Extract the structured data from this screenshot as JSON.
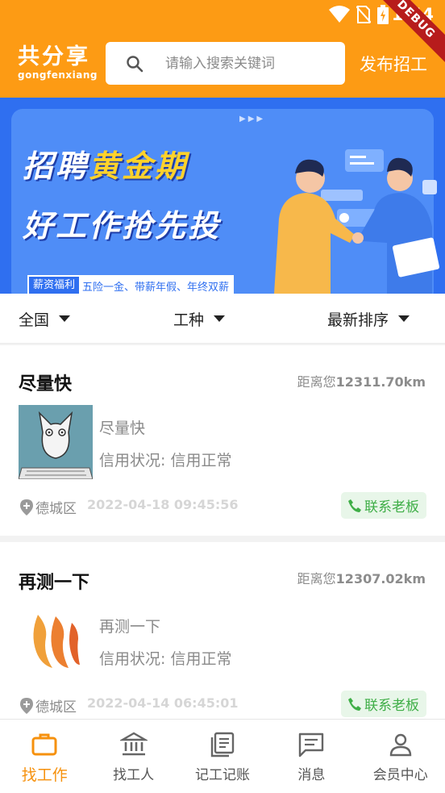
{
  "status_bar": {
    "time": "1:44",
    "debug_label": "DEBUG"
  },
  "header": {
    "logo_main": "共分享",
    "logo_sub": "gongfenxiang",
    "search_placeholder": "请输入搜索关键词",
    "post_job_label": "发布招工",
    "brand_color": "#fd9b14"
  },
  "banner": {
    "title_line1_prefix": "招聘",
    "title_line1_highlight": "黄金期",
    "title_line2": "好工作抢先投",
    "tag_chip": "薪资福利",
    "tag_text": "五险一金、带薪年假、年终双薪"
  },
  "filters": [
    {
      "label": "全国"
    },
    {
      "label": "工种"
    },
    {
      "label": "最新排序"
    }
  ],
  "jobs": [
    {
      "title": "尽量快",
      "distance_prefix": "距离您",
      "distance_value": "12311.70km",
      "name": "尽量快",
      "credit": "信用状况:  信用正常",
      "location": "德城区",
      "time": "2022-04-18 09:45:56",
      "contact_label": "联系老板",
      "thumb_icon": "cat-keyboard-avatar"
    },
    {
      "title": "再测一下",
      "distance_prefix": "距离您",
      "distance_value": "12307.02km",
      "name": "再测一下",
      "credit": "信用状况:  信用正常",
      "location": "德城区",
      "time": "2022-04-14 06:45:01",
      "contact_label": "联系老板",
      "thumb_icon": "flame-logo"
    }
  ],
  "bottom_nav": [
    {
      "label": "找工作",
      "icon": "briefcase-icon",
      "active": true
    },
    {
      "label": "找工人",
      "icon": "bank-icon",
      "active": false
    },
    {
      "label": "记工记账",
      "icon": "ledger-icon",
      "active": false
    },
    {
      "label": "消息",
      "icon": "message-icon",
      "active": false
    },
    {
      "label": "会员中心",
      "icon": "person-icon",
      "active": false
    }
  ],
  "colors": {
    "active_tab": "#f6910d",
    "contact_green": "#3fae47",
    "banner_blue": "#2f6ff0"
  }
}
